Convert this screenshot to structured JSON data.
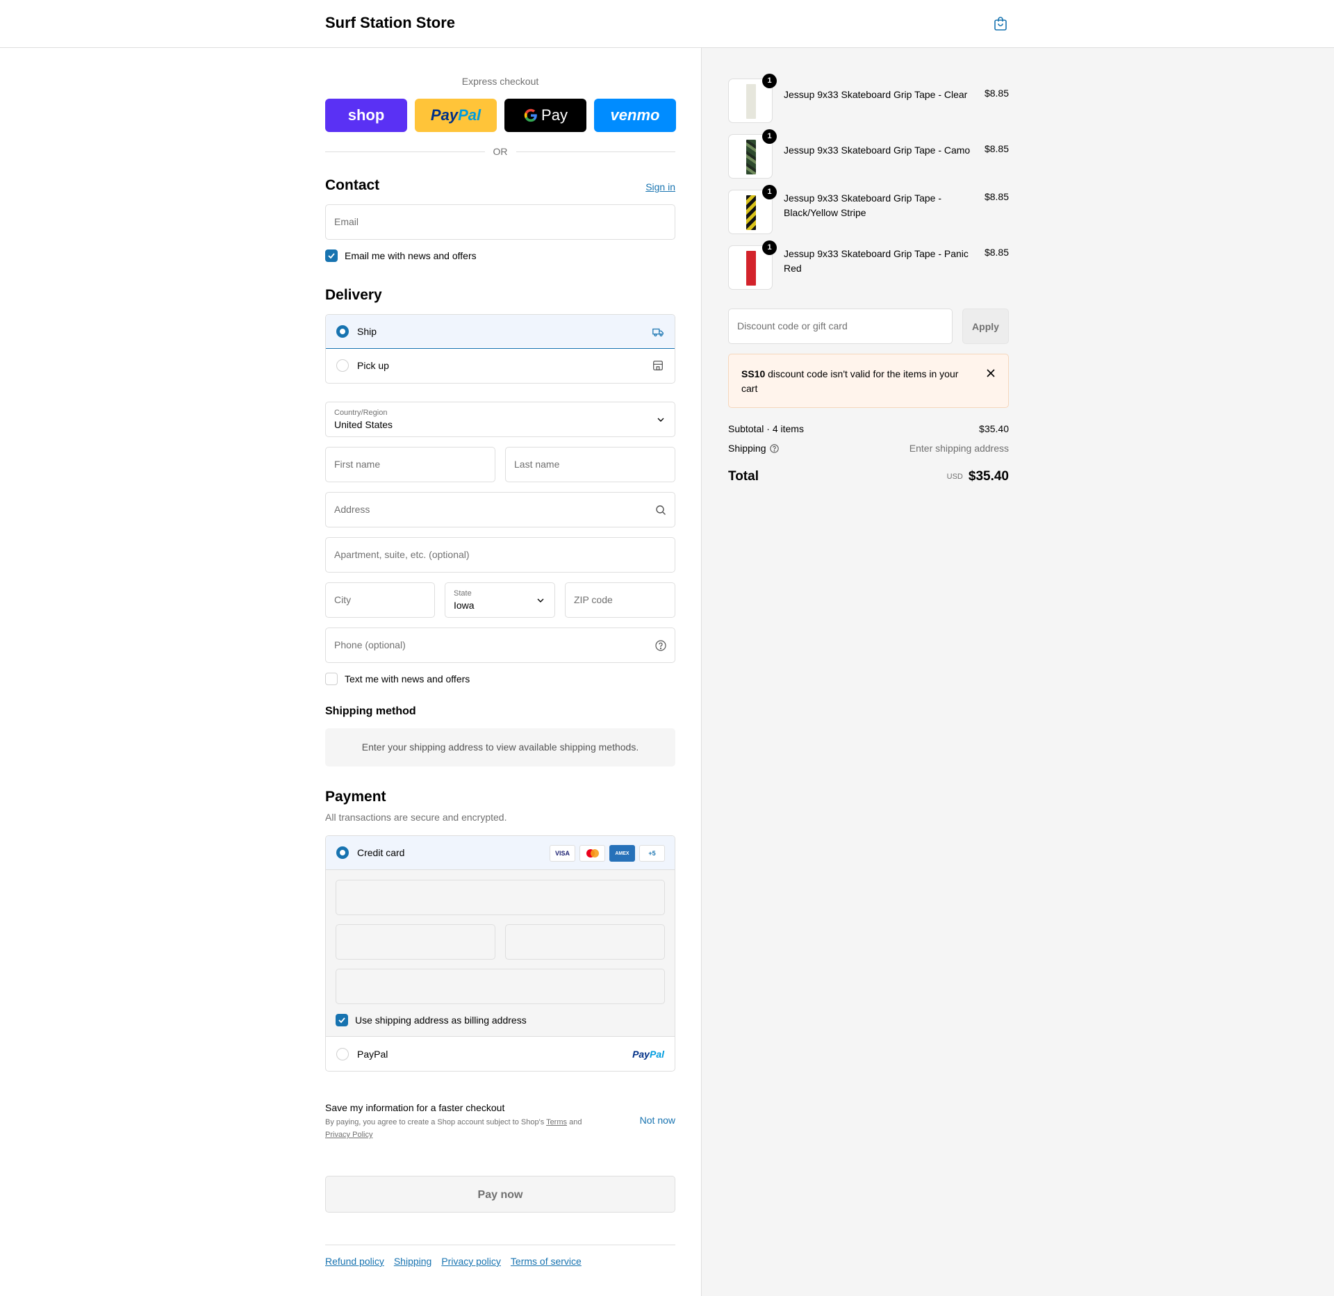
{
  "header": {
    "store_name": "Surf Station Store"
  },
  "express": {
    "label": "Express checkout",
    "buttons": {
      "shop": "shop",
      "paypal_a": "Pay",
      "paypal_b": "Pal",
      "gpay": "Pay",
      "venmo": "venmo"
    },
    "or": "OR"
  },
  "contact": {
    "title": "Contact",
    "sign_in": "Sign in",
    "email_placeholder": "Email",
    "news_label": "Email me with news and offers"
  },
  "delivery": {
    "title": "Delivery",
    "options": [
      "Ship",
      "Pick up"
    ],
    "country_label": "Country/Region",
    "country_value": "United States",
    "first_name": "First name",
    "last_name": "Last name",
    "address": "Address",
    "apartment": "Apartment, suite, etc. (optional)",
    "city": "City",
    "state_label": "State",
    "state_value": "Iowa",
    "zip": "ZIP code",
    "phone": "Phone (optional)",
    "text_label": "Text me with news and offers"
  },
  "shipping_method": {
    "title": "Shipping method",
    "info": "Enter your shipping address to view available shipping methods."
  },
  "payment": {
    "title": "Payment",
    "subtitle": "All transactions are secure and encrypted.",
    "credit_card": "Credit card",
    "cards": [
      "VISA",
      "MC",
      "AMEX",
      "+5"
    ],
    "billing_label": "Use shipping address as billing address",
    "paypal": "PayPal",
    "paypal_logo_a": "Pay",
    "paypal_logo_b": "Pal"
  },
  "save_info": {
    "title": "Save my information for a faster checkout",
    "legal_a": "By paying, you agree to create a Shop account subject to Shop's",
    "terms": "Terms",
    "and": "and",
    "privacy": "Privacy Policy",
    "not_now": "Not now"
  },
  "pay_now": "Pay now",
  "footer": [
    "Refund policy",
    "Shipping",
    "Privacy policy",
    "Terms of service"
  ],
  "cart": {
    "items": [
      {
        "name": "Jessup 9x33 Skateboard Grip Tape - Clear",
        "price": "$8.85",
        "qty": "1",
        "color": "#e6e6dc"
      },
      {
        "name": "Jessup 9x33 Skateboard Grip Tape - Camo",
        "price": "$8.85",
        "qty": "1",
        "color": "#3e5a3c"
      },
      {
        "name": "Jessup 9x33 Skateboard Grip Tape - Black/Yellow Stripe",
        "price": "$8.85",
        "qty": "1",
        "color": "#d9c21a"
      },
      {
        "name": "Jessup 9x33 Skateboard Grip Tape - Panic Red",
        "price": "$8.85",
        "qty": "1",
        "color": "#d3232b"
      }
    ],
    "discount_placeholder": "Discount code or gift card",
    "apply": "Apply",
    "alert_code": "SS10",
    "alert_text": "discount code isn't valid for the items in your cart",
    "subtotal_label": "Subtotal · 4 items",
    "subtotal_value": "$35.40",
    "shipping_label": "Shipping",
    "shipping_value": "Enter shipping address",
    "total_label": "Total",
    "currency": "USD",
    "total_value": "$35.40"
  }
}
